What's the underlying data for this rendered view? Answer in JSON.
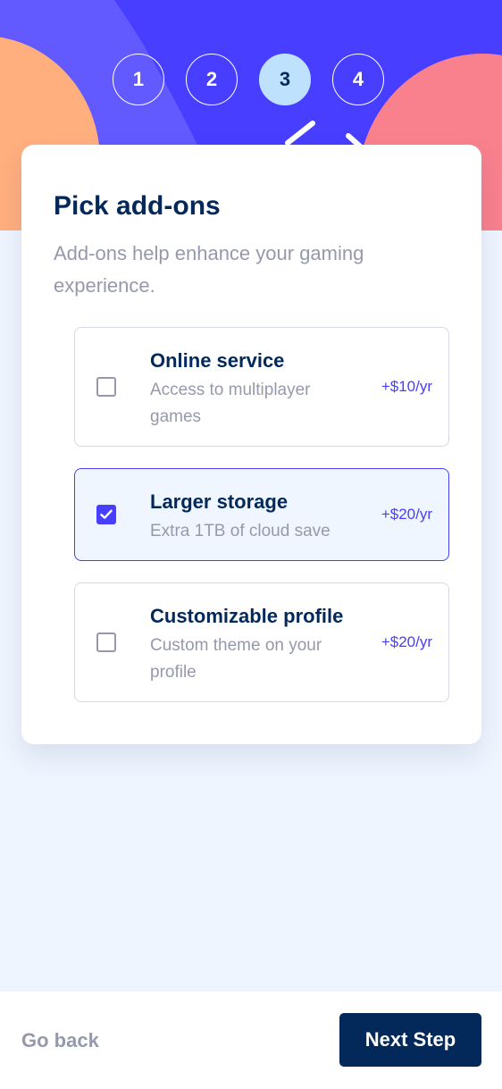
{
  "colors": {
    "header_bg": "#483EFF",
    "orange_blob": "#FFAF7E",
    "pink_blob": "#F9818E",
    "purple_blob": "#6259FF",
    "marine_blue": "#02295A",
    "accent": "#483EFF",
    "light_bg": "#EFF5FF"
  },
  "steps": [
    {
      "number": "1",
      "active": false
    },
    {
      "number": "2",
      "active": false
    },
    {
      "number": "3",
      "active": true
    },
    {
      "number": "4",
      "active": false
    }
  ],
  "card": {
    "title": "Pick add-ons",
    "description": "Add-ons help enhance your gaming experience."
  },
  "addons": [
    {
      "name": "Online service",
      "description": "Access to multiplayer games",
      "price": "+$10/yr",
      "checked": false
    },
    {
      "name": "Larger storage",
      "description": "Extra 1TB of cloud save",
      "price": "+$20/yr",
      "checked": true
    },
    {
      "name": "Customizable profile",
      "description": "Custom theme on your profile",
      "price": "+$20/yr",
      "checked": false
    }
  ],
  "footer": {
    "back_label": "Go back",
    "next_label": "Next Step"
  },
  "icons": {
    "checkmark": "checkmark-icon"
  }
}
